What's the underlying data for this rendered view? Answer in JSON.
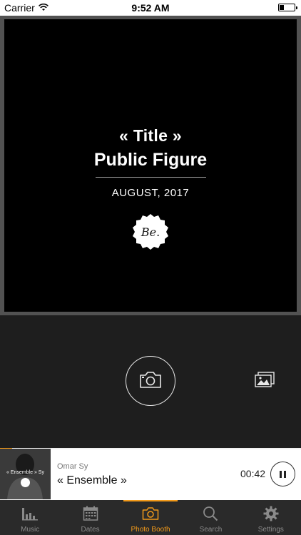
{
  "status_bar": {
    "carrier": "Carrier",
    "time": "9:52 AM",
    "icons": [
      "wifi-icon",
      "battery-icon"
    ]
  },
  "preview": {
    "title": "« Title »",
    "subtitle": "Public Figure",
    "date": "AUGUST, 2017",
    "badge_text": "Be."
  },
  "controls": {
    "capture_icon": "camera-icon",
    "gallery_icon": "photos-stack-icon"
  },
  "player": {
    "artist": "Omar Sy",
    "track": "« Ensemble »",
    "elapsed": "00:42",
    "progress_fraction": 0.04,
    "art_text": "« Ensemble » Sy",
    "pause_icon": "pause-icon"
  },
  "tabs": [
    {
      "label": "Music",
      "icon": "music-bars-icon"
    },
    {
      "label": "Dates",
      "icon": "calendar-icon"
    },
    {
      "label": "Photo Booth",
      "icon": "camera-icon",
      "active": true
    },
    {
      "label": "Search",
      "icon": "search-icon"
    },
    {
      "label": "Settings",
      "icon": "gear-icon"
    }
  ],
  "colors": {
    "accent": "#f29a1a",
    "background": "#1e1e1e",
    "tab_bar": "#2a2a2a",
    "inactive_tab": "#8a8a8a"
  }
}
